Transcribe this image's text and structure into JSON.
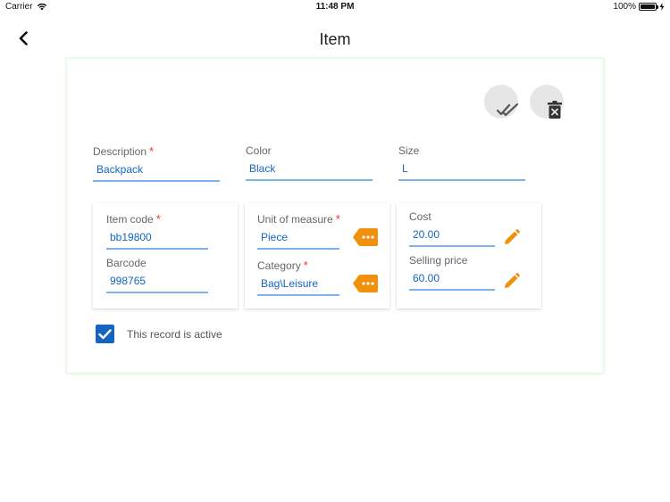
{
  "status_bar": {
    "carrier": "Carrier",
    "time": "11:48 PM",
    "battery": "100%",
    "battery_level": 1.0
  },
  "nav": {
    "title": "Item",
    "back_icon": "chevron-left-icon"
  },
  "actions": {
    "confirm_icon": "double-check-icon",
    "delete_icon": "trash-x-icon"
  },
  "fields": {
    "description": {
      "label": "Description",
      "required": "*",
      "value": "Backpack"
    },
    "color": {
      "label": "Color",
      "value": "Black"
    },
    "size": {
      "label": "Size",
      "value": "L"
    },
    "item_code": {
      "label": "Item code",
      "required": "*",
      "value": "bb19800"
    },
    "barcode": {
      "label": "Barcode",
      "value": "998765"
    },
    "unit_of_measure": {
      "label": "Unit of measure",
      "required": "*",
      "value": "Piece",
      "picker_icon": "tag-more-icon"
    },
    "category": {
      "label": "Category",
      "required": "*",
      "value": "Bag\\Leisure",
      "picker_icon": "tag-more-icon"
    },
    "cost": {
      "label": "Cost",
      "value": "20.00",
      "edit_icon": "pencil-icon"
    },
    "selling_price": {
      "label": "Selling price",
      "value": "60.00",
      "edit_icon": "pencil-icon"
    }
  },
  "active": {
    "label": "This record is active",
    "checked": true
  },
  "colors": {
    "accent_blue": "#1565c0",
    "underline_blue": "#7db3ec",
    "orange": "#f0900c",
    "required_red": "#e53935"
  }
}
